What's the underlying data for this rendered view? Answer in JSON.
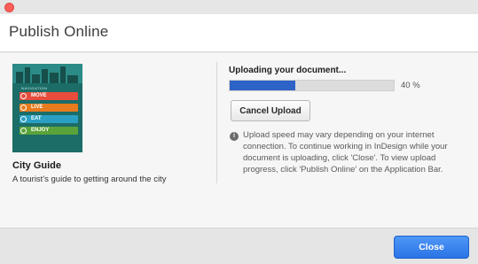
{
  "window": {
    "title": "Publish Online"
  },
  "document": {
    "cover_label": "NAVIGATION",
    "cover_tags": [
      {
        "text": "MOVE",
        "color": "#e74c3c"
      },
      {
        "text": "LIVE",
        "color": "#e87b1e"
      },
      {
        "text": "EAT",
        "color": "#2a9fc4"
      },
      {
        "text": "ENJOY",
        "color": "#5aa33a"
      }
    ],
    "title": "City Guide",
    "description": "A tourist's guide to getting around the city"
  },
  "upload": {
    "title": "Uploading your document...",
    "progress": 0.4,
    "progress_label": "40 %",
    "cancel_label": "Cancel Upload",
    "info_icon": "i",
    "info_text": "Upload speed may vary depending on your internet connection. To continue working in InDesign while your document is uploading, click 'Close'. To view upload progress, click 'Publish Online' on the Application Bar."
  },
  "footer": {
    "close_label": "Close"
  },
  "colors": {
    "accent": "#2d62c6",
    "close_button": "#2a74e6"
  }
}
